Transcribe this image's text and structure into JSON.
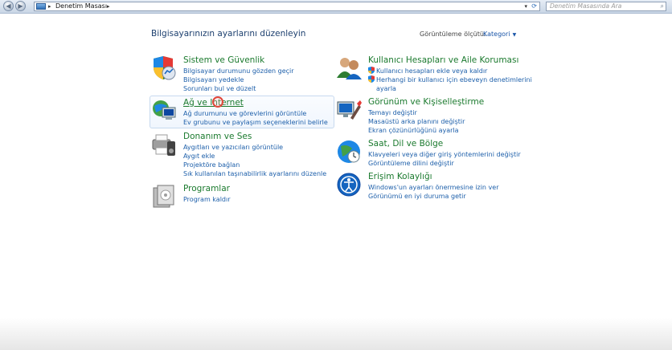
{
  "address_bar": {
    "breadcrumb": "Denetim Masası",
    "search_placeholder": "Denetim Masasında Ara"
  },
  "page": {
    "heading": "Bilgisayarınızın ayarlarını düzenleyin",
    "view_by_label": "Görüntüleme ölçütü:",
    "view_by_value": "Kategori"
  },
  "categories": {
    "system": {
      "title": "Sistem ve Güvenlik",
      "icon": "shield-security-icon",
      "links": [
        "Bilgisayar durumunu gözden geçir",
        "Bilgisayarı yedekle",
        "Sorunları bul ve düzelt"
      ]
    },
    "network": {
      "title": "Ağ ve Internet",
      "icon": "network-globe-icon",
      "links": [
        "Ağ durumunu ve görevlerini görüntüle",
        "Ev grubunu ve paylaşım seçeneklerini belirle"
      ]
    },
    "hardware": {
      "title": "Donanım ve Ses",
      "icon": "printer-speaker-icon",
      "links": [
        "Aygıtları ve yazıcıları görüntüle",
        "Aygıt ekle",
        "Projektöre bağlan",
        "Sık kullanılan taşınabilirlik ayarlarını düzenle"
      ]
    },
    "programs": {
      "title": "Programlar",
      "icon": "programs-box-icon",
      "links": [
        "Program kaldır"
      ]
    },
    "users": {
      "title": "Kullanıcı Hesapları ve Aile Koruması",
      "icon": "users-icon",
      "links": [
        "Kullanıcı hesapları ekle veya kaldır",
        "Herhangi bir kullanıcı için ebeveyn denetimlerini",
        "ayarla"
      ]
    },
    "appearance": {
      "title": "Görünüm ve Kişiselleştirme",
      "icon": "monitor-brush-icon",
      "links": [
        "Temayı değiştir",
        "Masaüstü arka planını değiştir",
        "Ekran çözünürlüğünü ayarla"
      ]
    },
    "clock": {
      "title": "Saat, Dil ve Bölge",
      "icon": "clock-globe-icon",
      "links": [
        "Klavyeleri veya diğer giriş yöntemlerini değiştir",
        "Görüntüleme dilini değiştir"
      ]
    },
    "ease": {
      "title": "Erişim Kolaylığı",
      "icon": "ease-of-access-icon",
      "links": [
        "Windows'un ayarları önermesine izin ver",
        "Görünümü en iyi duruma getir"
      ]
    }
  },
  "colors": {
    "category_title": "#1b7a2e",
    "link": "#1d5faa",
    "heading": "#1c3f6e"
  }
}
